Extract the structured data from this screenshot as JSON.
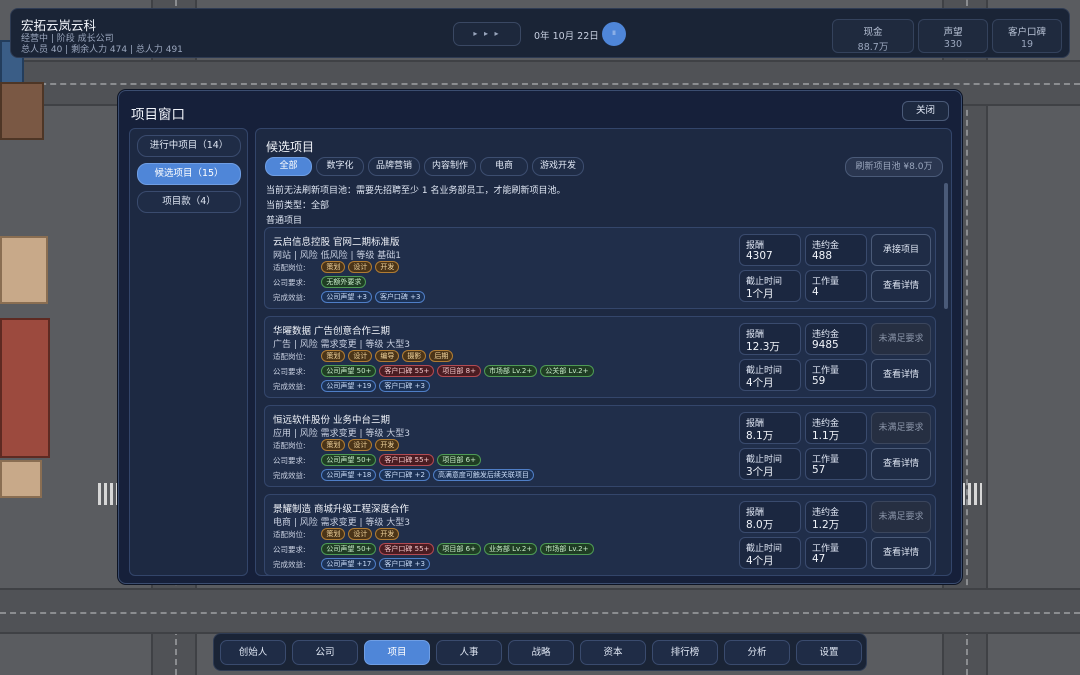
{
  "company": {
    "name": "宏拓云岚云科",
    "status": "经营中 | 阶段 成长公司",
    "stats": "总人员 40 | 剩余人力 474 | 总人力 491"
  },
  "time": {
    "speed_label": "▸ ▸ ▸",
    "date": "0年 10月 22日",
    "pause_label": "II"
  },
  "resources": [
    {
      "label": "现金",
      "value": "88.7万"
    },
    {
      "label": "声望",
      "value": "330"
    },
    {
      "label": "客户口碑",
      "value": "19"
    }
  ],
  "modal": {
    "title": "项目窗口",
    "close_label": "关闭",
    "left_tabs": [
      {
        "label": "进行中项目（14）",
        "active": false
      },
      {
        "label": "候选项目（15）",
        "active": true
      },
      {
        "label": "项目款（4）",
        "active": false
      }
    ],
    "panel_title": "候选项目",
    "filters": [
      {
        "label": "全部",
        "active": true
      },
      {
        "label": "数字化",
        "active": false
      },
      {
        "label": "品牌营销",
        "active": false
      },
      {
        "label": "内容制作",
        "active": false
      },
      {
        "label": "电商",
        "active": false
      },
      {
        "label": "游戏开发",
        "active": false
      }
    ],
    "refresh_label": "刷新项目池 ¥8.0万",
    "notice": "当前无法刷新项目池：需要先招聘至少 1 名业务部员工，才能刷新项目池。",
    "current_type": "当前类型：全部",
    "section_label": "普通项目",
    "row_labels": {
      "roles": "适配岗位:",
      "requirements": "公司要求:",
      "rewards": "完成效益:"
    },
    "metric_labels": {
      "reward": "报酬",
      "penalty": "违约金",
      "deadline": "截止时间",
      "workload": "工作量"
    },
    "detail_label": "查看详情",
    "projects": [
      {
        "name": "云启信息控股 官网二期标准版",
        "meta": "网站 | 风险 低风险 | 等级 基础1",
        "roles": [
          "策划",
          "设计",
          "开发"
        ],
        "requirements": [
          {
            "text": "无额外要求",
            "ok": true
          }
        ],
        "rewards": [
          "公司声望 +3",
          "客户口碑 +3"
        ],
        "reward": "4307",
        "penalty": "488",
        "deadline": "1个月",
        "workload": "4",
        "action": "承接项目",
        "action_enabled": true
      },
      {
        "name": "华曜数据 广告创意合作三期",
        "meta": "广告 | 风险 需求变更 | 等级 大型3",
        "roles": [
          "策划",
          "设计",
          "编导",
          "摄影",
          "后期"
        ],
        "requirements": [
          {
            "text": "公司声望 50+",
            "ok": true
          },
          {
            "text": "客户口碑 55+",
            "ok": false
          },
          {
            "text": "项目部 8+",
            "ok": false
          },
          {
            "text": "市场部 Lv.2+",
            "ok": true
          },
          {
            "text": "公关部 Lv.2+",
            "ok": true
          }
        ],
        "rewards": [
          "公司声望 +19",
          "客户口碑 +3"
        ],
        "reward": "12.3万",
        "penalty": "9485",
        "deadline": "4个月",
        "workload": "59",
        "action": "未满足要求",
        "action_enabled": false
      },
      {
        "name": "恒远软件股份 业务中台三期",
        "meta": "应用 | 风险 需求变更 | 等级 大型3",
        "roles": [
          "策划",
          "设计",
          "开发"
        ],
        "requirements": [
          {
            "text": "公司声望 50+",
            "ok": true
          },
          {
            "text": "客户口碑 55+",
            "ok": false
          },
          {
            "text": "项目部 6+",
            "ok": true
          }
        ],
        "rewards": [
          "公司声望 +18",
          "客户口碑 +2",
          "高满意度可触发后续关联项目"
        ],
        "reward": "8.1万",
        "penalty": "1.1万",
        "deadline": "3个月",
        "workload": "57",
        "action": "未满足要求",
        "action_enabled": false
      },
      {
        "name": "景耀制造 商城升级工程深度合作",
        "meta": "电商 | 风险 需求变更 | 等级 大型3",
        "roles": [
          "策划",
          "设计",
          "开发"
        ],
        "requirements": [
          {
            "text": "公司声望 50+",
            "ok": true
          },
          {
            "text": "客户口碑 55+",
            "ok": false
          },
          {
            "text": "项目部 6+",
            "ok": true
          },
          {
            "text": "业务部 Lv.2+",
            "ok": true
          },
          {
            "text": "市场部 Lv.2+",
            "ok": true
          }
        ],
        "rewards": [
          "公司声望 +17",
          "客户口碑 +3"
        ],
        "reward": "8.0万",
        "penalty": "1.2万",
        "deadline": "4个月",
        "workload": "47",
        "action": "未满足要求",
        "action_enabled": false
      }
    ]
  },
  "nav": [
    {
      "label": "创始人",
      "active": false
    },
    {
      "label": "公司",
      "active": false
    },
    {
      "label": "项目",
      "active": true
    },
    {
      "label": "人事",
      "active": false
    },
    {
      "label": "战略",
      "active": false
    },
    {
      "label": "资本",
      "active": false
    },
    {
      "label": "排行榜",
      "active": false
    },
    {
      "label": "分析",
      "active": false
    },
    {
      "label": "设置",
      "active": false
    }
  ]
}
